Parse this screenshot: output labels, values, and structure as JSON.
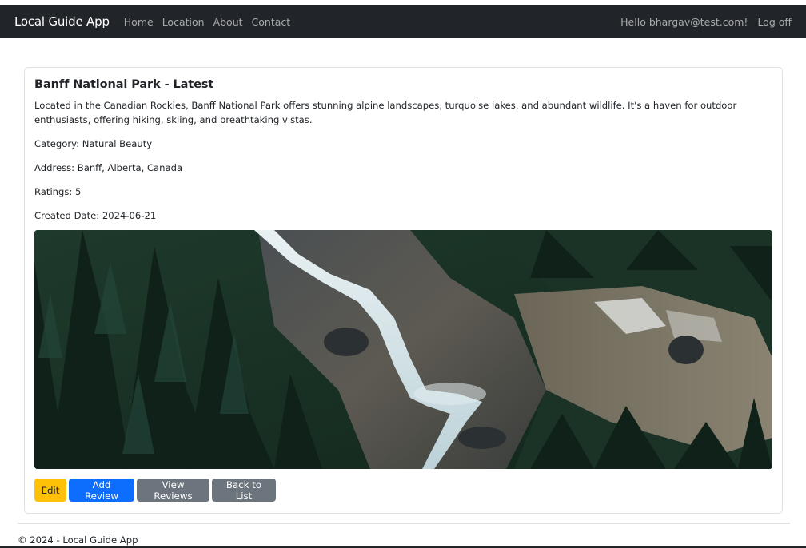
{
  "navbar": {
    "brand": "Local Guide App",
    "links": [
      "Home",
      "Location",
      "About",
      "Contact"
    ],
    "greeting": "Hello bhargav@test.com!",
    "logoff": "Log off"
  },
  "place": {
    "title": "Banff National Park - Latest",
    "description": "Located in the Canadian Rockies, Banff National Park offers stunning alpine landscapes, turquoise lakes, and abundant wildlife. It's a haven for outdoor enthusiasts, offering hiking, skiing, and breathtaking vistas.",
    "category": "Category: Natural Beauty",
    "address": "Address: Banff, Alberta, Canada",
    "ratings": "Ratings: 5",
    "created": "Created Date: 2024-06-21"
  },
  "buttons": {
    "edit": "Edit",
    "add_review": "Add Review",
    "view_reviews": "View Reviews",
    "back": "Back to List"
  },
  "footer": {
    "text": "© 2024 - Local Guide App"
  },
  "colors": {
    "navbar": "#212529",
    "warning": "#ffc107",
    "primary": "#0d6efd",
    "secondary": "#6c757d"
  }
}
